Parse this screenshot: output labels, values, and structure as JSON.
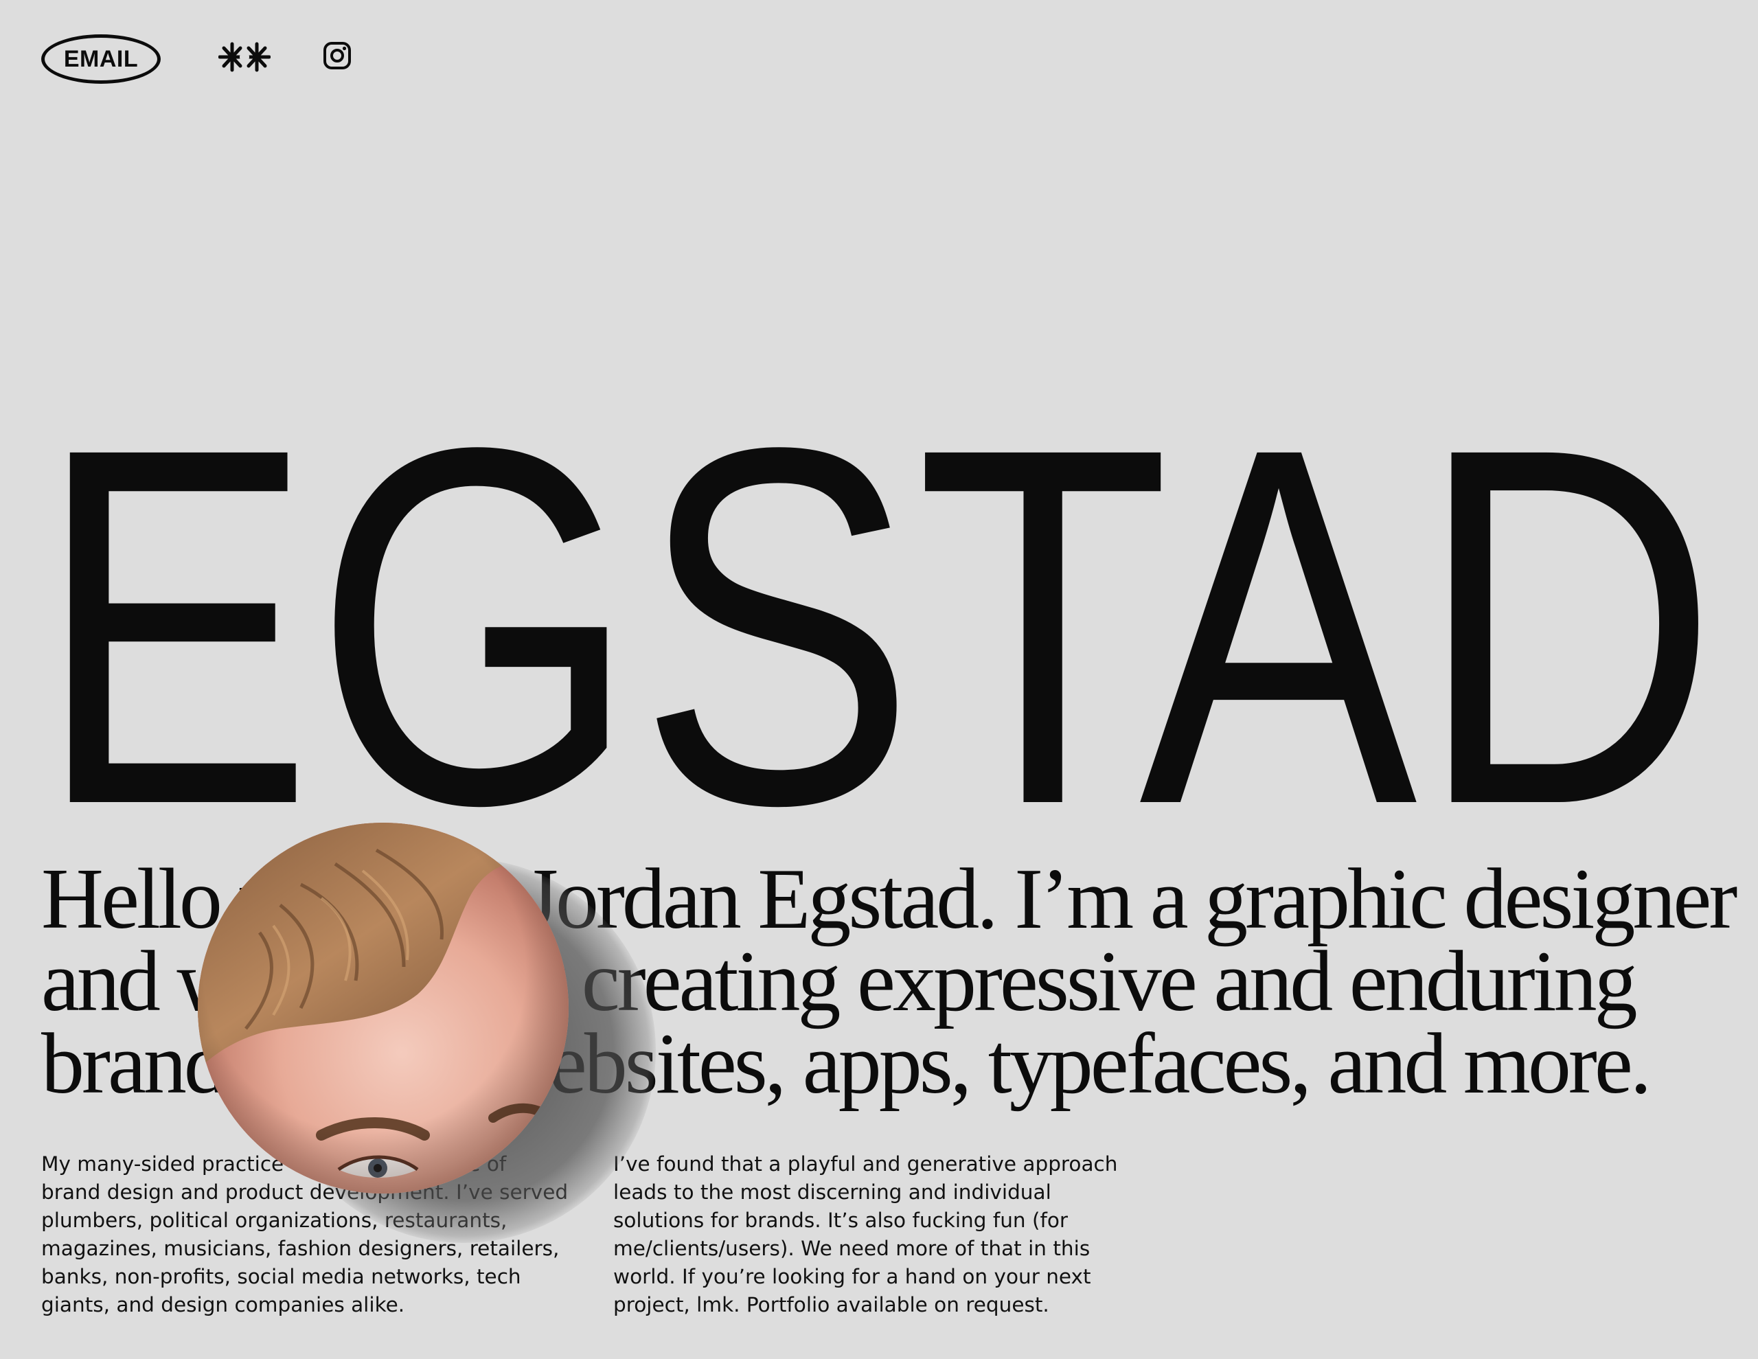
{
  "header": {
    "email_label": "EMAIL",
    "logo_icon": "double-star-icon",
    "social_icon": "instagram-icon"
  },
  "wordmark": {
    "text": "EGSTAD"
  },
  "intro": {
    "lines": [
      "Hello y             Jordan Egstad. I’m a graphic designer",
      "and w              er creating expressive and enduring",
      "brand              websites, apps, typefaces, and more."
    ]
  },
  "columns": {
    "left": [
      "My many-sided practice                     ecade of",
      "brand design and product development. I’ve served",
      "plumbers, political organizations, restaurants,",
      "magazines, musicians, fashion designers, retailers,",
      "banks, non-profits, social media networks, tech",
      "giants, and design companies alike."
    ],
    "right": [
      "I’ve found that a playful and generative approach",
      "leads to the most discerning and individual",
      "solutions for brands. It’s also fucking fun (for",
      "me/clients/users). We need more of that in this",
      "world. If you’re looking for a hand on your next",
      "project, lmk. Portfolio available on request."
    ]
  },
  "colors": {
    "background": "#dddddd",
    "ink": "#0c0c0c"
  }
}
